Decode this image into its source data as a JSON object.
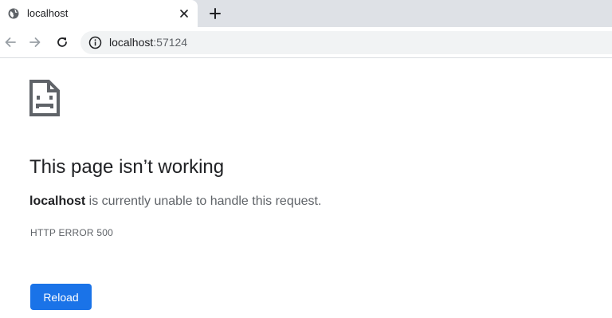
{
  "tab": {
    "title": "localhost",
    "favicon": "globe-icon",
    "close_icon": "close-icon"
  },
  "new_tab_icon": "plus-icon",
  "toolbar": {
    "back_icon": "back-arrow-icon",
    "forward_icon": "forward-arrow-icon",
    "reload_icon": "reload-icon",
    "site_info_icon": "info-icon",
    "url_host": "localhost",
    "url_port": ":57124"
  },
  "error_page": {
    "icon": "sad-page-icon",
    "title": "This page isn’t working",
    "host": "localhost",
    "description_rest": " is currently unable to handle this request.",
    "error_code": "HTTP ERROR 500",
    "reload_label": "Reload"
  },
  "colors": {
    "tabstrip_bg": "#dee1e6",
    "omnibox_bg": "#f1f3f4",
    "accent": "#1a73e8",
    "text_primary": "#202124",
    "text_secondary": "#5f6368"
  }
}
